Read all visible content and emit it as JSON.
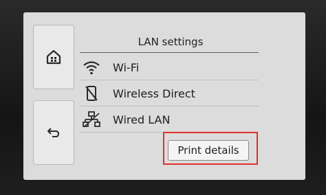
{
  "screen": {
    "title": "LAN settings",
    "items": [
      {
        "label": "Wi-Fi",
        "icon": "wifi-icon"
      },
      {
        "label": "Wireless Direct",
        "icon": "wireless-direct-icon"
      },
      {
        "label": "Wired LAN",
        "icon": "wired-lan-icon"
      }
    ],
    "print_details_label": "Print details"
  },
  "side": {
    "home_icon": "home-icon",
    "back_icon": "back-arrow-icon"
  },
  "colors": {
    "highlight": "#e0302b",
    "screen_bg": "#dcdcdc"
  }
}
